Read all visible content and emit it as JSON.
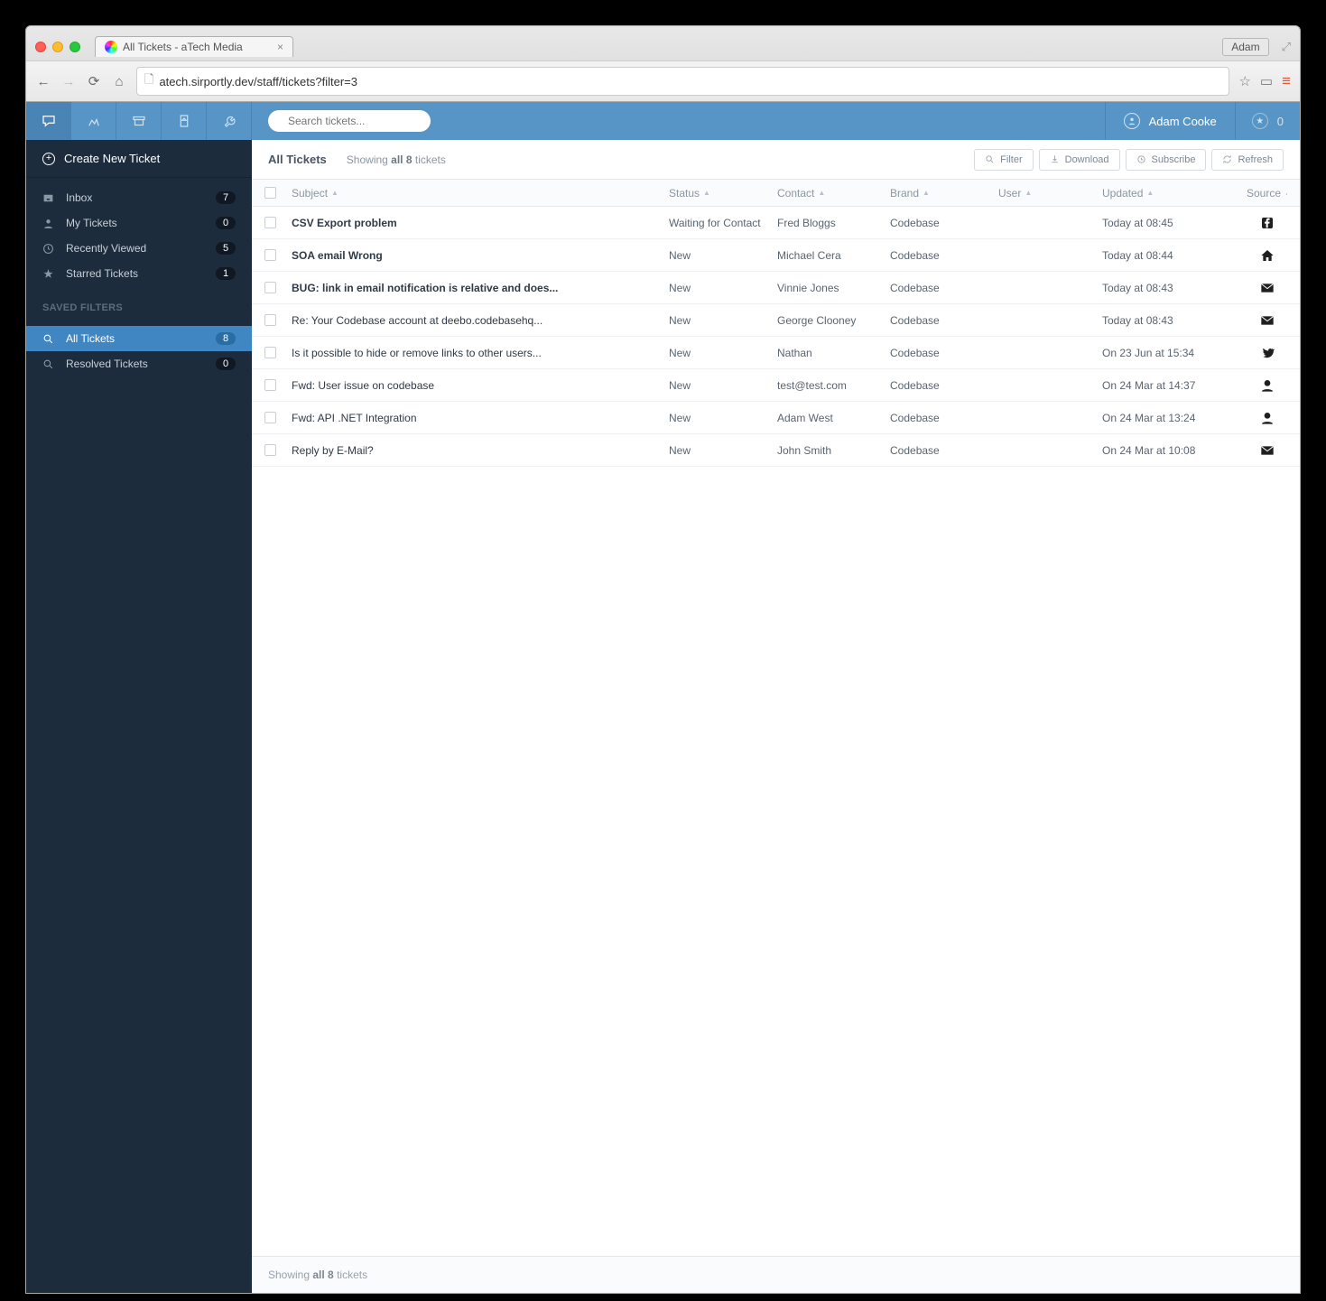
{
  "browser": {
    "tab_title": "All Tickets - aTech Media",
    "url_display": "atech.sirportly.dev/staff/tickets?filter=3",
    "profile": "Adam"
  },
  "topbar": {
    "search_placeholder": "Search tickets...",
    "user_name": "Adam Cooke",
    "notif_count": "0"
  },
  "sidebar": {
    "create_label": "Create New Ticket",
    "items": [
      {
        "icon": "inbox",
        "label": "Inbox",
        "count": "7"
      },
      {
        "icon": "person",
        "label": "My Tickets",
        "count": "0"
      },
      {
        "icon": "clock",
        "label": "Recently Viewed",
        "count": "5"
      },
      {
        "icon": "star",
        "label": "Starred Tickets",
        "count": "1"
      }
    ],
    "saved_header": "SAVED FILTERS",
    "filters": [
      {
        "icon": "search",
        "label": "All Tickets",
        "count": "8",
        "active": true
      },
      {
        "icon": "search",
        "label": "Resolved Tickets",
        "count": "0"
      }
    ]
  },
  "toolbar": {
    "title": "All Tickets",
    "showing_pre": "Showing ",
    "showing_bold": "all 8",
    "showing_post": " tickets",
    "buttons": {
      "filter": "Filter",
      "download": "Download",
      "subscribe": "Subscribe",
      "refresh": "Refresh"
    }
  },
  "columns": {
    "subject": "Subject",
    "status": "Status",
    "contact": "Contact",
    "brand": "Brand",
    "user": "User",
    "updated": "Updated",
    "source": "Source"
  },
  "rows": [
    {
      "subject": "CSV Export problem",
      "bold": true,
      "status": "Waiting for Contact",
      "status_class": "wait",
      "contact": "Fred Bloggs",
      "brand": "Codebase",
      "user": "",
      "updated": "Today at 08:45",
      "source": "facebook"
    },
    {
      "subject": "SOA email Wrong",
      "bold": true,
      "status": "New",
      "status_class": "new",
      "contact": "Michael Cera",
      "brand": "Codebase",
      "user": "",
      "updated": "Today at 08:44",
      "source": "home"
    },
    {
      "subject": "BUG: link in email notification is relative and does...",
      "bold": true,
      "status": "New",
      "status_class": "new",
      "contact": "Vinnie Jones",
      "brand": "Codebase",
      "user": "",
      "updated": "Today at 08:43",
      "source": "mail"
    },
    {
      "subject": "Re: Your Codebase account at deebo.codebasehq...",
      "bold": false,
      "status": "New",
      "status_class": "new",
      "contact": "George Clooney",
      "brand": "Codebase",
      "user": "",
      "updated": "Today at 08:43",
      "source": "mail"
    },
    {
      "subject": "Is it possible to hide or remove links to other users...",
      "bold": false,
      "status": "New",
      "status_class": "new",
      "contact": "Nathan",
      "brand": "Codebase",
      "user": "",
      "updated": "On 23 Jun at 15:34",
      "source": "twitter"
    },
    {
      "subject": "Fwd: User issue on codebase",
      "bold": false,
      "status": "New",
      "status_class": "new",
      "contact": "test@test.com",
      "brand": "Codebase",
      "user": "",
      "updated": "On 24 Mar at 14:37",
      "source": "person"
    },
    {
      "subject": "Fwd: API .NET Integration",
      "bold": false,
      "status": "New",
      "status_class": "new",
      "contact": "Adam West",
      "brand": "Codebase",
      "user": "",
      "updated": "On 24 Mar at 13:24",
      "source": "person"
    },
    {
      "subject": "Reply by E-Mail?",
      "bold": false,
      "status": "New",
      "status_class": "new",
      "contact": "John Smith",
      "brand": "Codebase",
      "user": "",
      "updated": "On 24 Mar at 10:08",
      "source": "mail"
    }
  ],
  "footer": {
    "pre": "Showing ",
    "bold": "all 8",
    "post": " tickets"
  }
}
